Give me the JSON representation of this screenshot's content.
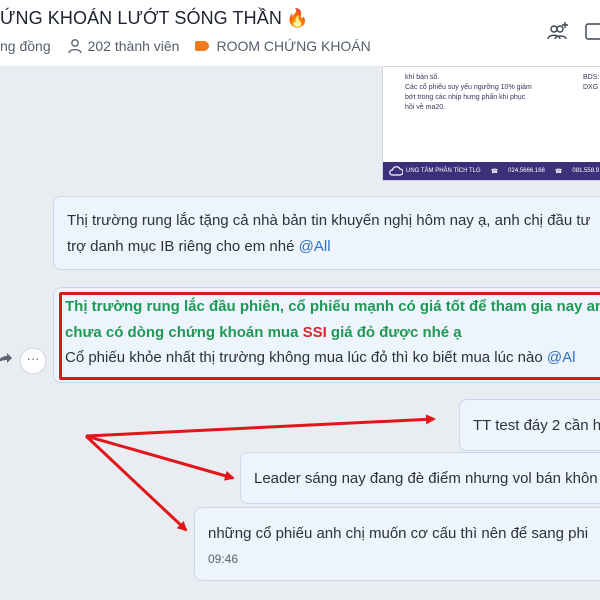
{
  "header": {
    "title": "ỨNG KHOÁN LƯỚT SÓNG THẦN",
    "title_icon": "fire-icon",
    "category": "ng đồng",
    "members": "202 thành viên",
    "tag": "ROOM CHỨNG KHOÁN",
    "tag_color": "#f07a1f"
  },
  "image_message": {
    "lines": [
      "khí bản sổ.",
      "Các cổ phiếu suy yếu ngưỡng 10% giảm",
      "bớt trong các nhịp hưng phấn khi phục",
      "hồi về ma20."
    ],
    "side_text": "BDS: DXG 2",
    "footer_brand": "UNG TÂM PHÂN TÍCH TLG",
    "footer_phone1": "024.5666.168",
    "footer_phone2": "081.558.9"
  },
  "messages": [
    {
      "line1": "Thị trường rung lắc tặng cả nhà bản tin khuyến nghị hôm nay ạ, anh chị đầu tư",
      "line2": "trợ danh mục IB riêng cho em nhé ",
      "mention": "@All"
    },
    {
      "green1": "Thị trường rung lắc đầu phiên, cổ phiếu mạnh có giá tốt để tham gia nay anh",
      "green2a": "chưa có dòng chứng khoán mua ",
      "green2_ssi": "SSI",
      "green2b": " giá đỏ được nhé ạ",
      "line3": "Cổ phiếu khỏe nhất thị trường không mua lúc đỏ thì ko biết mua lúc nào ",
      "mention": "@Al"
    },
    {
      "text": "TT test đáy 2 cần h"
    },
    {
      "text": "Leader sáng nay đang đè điểm nhưng vol bán khôn"
    },
    {
      "text": "những cổ phiếu anh chị muốn cơ cấu thì nên để sang phi",
      "time": "09:46"
    }
  ],
  "colors": {
    "accent_green": "#1f9a55",
    "highlight_red": "#d51a1a",
    "mention_blue": "#2f6fc4",
    "bubble_bg": "#eef4fd"
  }
}
